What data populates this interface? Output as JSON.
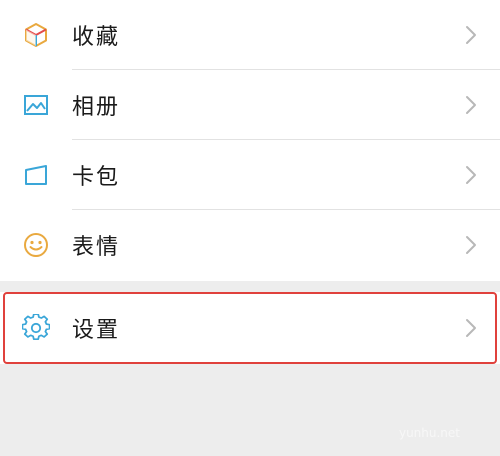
{
  "menu": {
    "items": [
      {
        "label": "收藏",
        "icon": "favorites-cube-icon"
      },
      {
        "label": "相册",
        "icon": "album-image-icon"
      },
      {
        "label": "卡包",
        "icon": "card-wallet-icon"
      },
      {
        "label": "表情",
        "icon": "smiley-face-icon"
      }
    ],
    "settings": {
      "label": "设置",
      "icon": "gear-icon"
    }
  },
  "colors": {
    "highlight_border": "#e0413c",
    "chevron": "#b8b8b8",
    "background": "#ededed"
  },
  "watermark": "yunhu.net"
}
